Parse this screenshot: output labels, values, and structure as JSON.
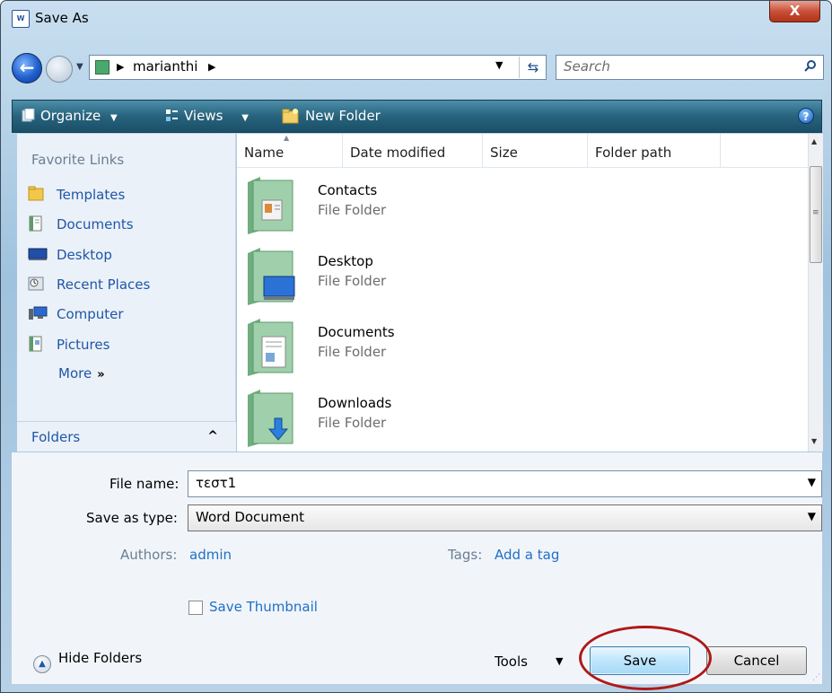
{
  "window": {
    "title": "Save As",
    "app_icon_text": "W",
    "close_label": "X"
  },
  "address": {
    "crumbs": [
      "marianthi"
    ],
    "search_placeholder": "Search"
  },
  "toolbar": {
    "organize_label": "Organize",
    "views_label": "Views",
    "new_folder_label": "New Folder",
    "help_label": "?"
  },
  "nav": {
    "header": "Favorite Links",
    "items": [
      {
        "label": "Templates",
        "icon": "folder-icon"
      },
      {
        "label": "Documents",
        "icon": "documents-icon"
      },
      {
        "label": "Desktop",
        "icon": "desktop-icon"
      },
      {
        "label": "Recent Places",
        "icon": "recent-places-icon"
      },
      {
        "label": "Computer",
        "icon": "computer-icon"
      },
      {
        "label": "Pictures",
        "icon": "pictures-icon"
      }
    ],
    "more_label": "More",
    "more_glyph": "»",
    "folders_label": "Folders"
  },
  "filelist": {
    "columns": [
      "Name",
      "Date modified",
      "Size",
      "Folder path"
    ],
    "items": [
      {
        "name": "Contacts",
        "type": "File Folder",
        "overlay": "contacts"
      },
      {
        "name": "Desktop",
        "type": "File Folder",
        "overlay": "desktop"
      },
      {
        "name": "Documents",
        "type": "File Folder",
        "overlay": "documents"
      },
      {
        "name": "Downloads",
        "type": "File Folder",
        "overlay": "downloads"
      }
    ]
  },
  "form": {
    "file_name_label": "File name:",
    "file_name_value": "τεστ1",
    "save_type_label": "Save as type:",
    "save_type_value": "Word Document",
    "authors_label": "Authors:",
    "authors_value": "admin",
    "tags_label": "Tags:",
    "tags_value": "Add a tag",
    "thumbnail_label": "Save Thumbnail",
    "thumbnail_checked": false
  },
  "footer": {
    "hide_folders_label": "Hide Folders",
    "tools_label": "Tools",
    "save_label": "Save",
    "cancel_label": "Cancel"
  },
  "colors": {
    "toolbar": "#27637d",
    "link": "#1f56a8",
    "highlight": "#b01818"
  }
}
